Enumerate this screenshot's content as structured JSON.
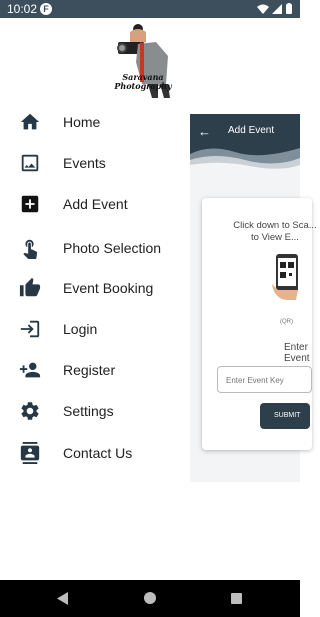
{
  "status_bar": {
    "time": "10:02",
    "app_icon_letter": "F"
  },
  "logo": {
    "line1": "Saravana",
    "line2": "Photography"
  },
  "menu": [
    {
      "label": "Home",
      "icon": "home-icon"
    },
    {
      "label": "Events",
      "icon": "image-icon"
    },
    {
      "label": "Add Event",
      "icon": "add-box-icon"
    },
    {
      "label": "Photo Selection",
      "icon": "touch-icon"
    },
    {
      "label": "Event Booking",
      "icon": "thumb-up-icon"
    },
    {
      "label": "Login",
      "icon": "login-icon"
    },
    {
      "label": "Register",
      "icon": "person-add-icon"
    },
    {
      "label": "Settings",
      "icon": "gear-icon"
    },
    {
      "label": "Contact Us",
      "icon": "contact-icon"
    }
  ],
  "background_screen": {
    "title": "Add Event",
    "instruction": "Click down to Sca... to View E...",
    "qr_label": "(QR)",
    "enter_label": "Enter Event",
    "input_placeholder": "Enter Event Key",
    "submit_label": "SUBMIT"
  },
  "colors": {
    "primary": "#2e3f4c",
    "status_bar": "#3d4f5d",
    "icon": "#263846"
  }
}
